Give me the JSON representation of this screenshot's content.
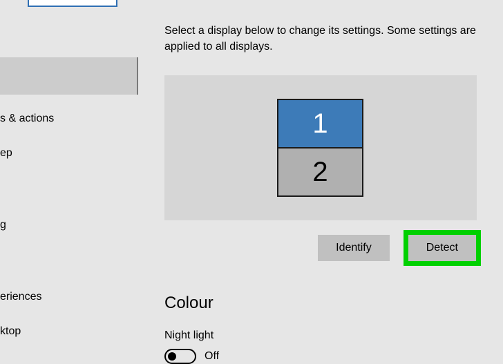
{
  "sidebar": {
    "items": [
      {
        "label": "s & actions"
      },
      {
        "label": "ep"
      },
      {
        "label": "g"
      },
      {
        "label": "eriences"
      },
      {
        "label": "ktop"
      }
    ]
  },
  "main": {
    "description": "Select a display below to change its settings. Some settings are applied to all displays.",
    "displays": {
      "d1": "1",
      "d2": "2"
    },
    "buttons": {
      "identify": "Identify",
      "detect": "Detect"
    },
    "colour": {
      "heading": "Colour",
      "night_light_label": "Night light",
      "night_light_state": "Off"
    }
  }
}
